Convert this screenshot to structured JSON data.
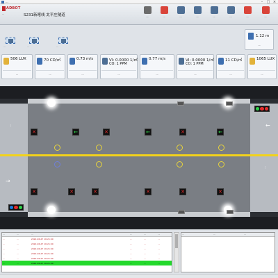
{
  "window": {
    "title": "..."
  },
  "header": {
    "logo_text": "ADBOT",
    "logo_sub": "...",
    "title": "S231新喀线 太平庄隧道",
    "buttons": [
      {
        "label": "...",
        "icon": "panda-icon",
        "color": "#6b6b6b"
      },
      {
        "label": "...",
        "icon": "alert-icon",
        "color": "#d9443a"
      },
      {
        "label": "...",
        "icon": "power-icon",
        "color": "#4d6e94"
      },
      {
        "label": "...",
        "icon": "user-icon",
        "color": "#4d6e94"
      },
      {
        "label": "...",
        "icon": "monitor-icon",
        "color": "#4d6e94"
      },
      {
        "label": "...",
        "icon": "stats-icon",
        "color": "#4d6e94"
      },
      {
        "label": "...",
        "icon": "log-icon",
        "color": "#d9443a"
      },
      {
        "label": "...",
        "icon": "exit-icon",
        "color": "#d9443a"
      }
    ]
  },
  "lane_icons": [
    {
      "label": "..."
    },
    {
      "label": "..."
    },
    {
      "label": "..."
    }
  ],
  "mini_panel": {
    "value": "1.12 m",
    "label": "..."
  },
  "sensors": [
    {
      "value": "506 LUX",
      "value2": "",
      "label": "..."
    },
    {
      "value": "70 CD/㎡",
      "value2": "",
      "label": "..."
    },
    {
      "value": "0.73 m/s",
      "value2": "",
      "label": "..."
    },
    {
      "value": "VI: 0.0000 1/㎡",
      "value2": "CO: 1 PPM",
      "label": "..."
    },
    {
      "value": "0.77 m/s",
      "value2": "",
      "label": "..."
    },
    {
      "value": "VI: 0.0000 1/㎡",
      "value2": "CO: 1 PPM",
      "label": "..."
    },
    {
      "value": "11 CD/㎡",
      "value2": "",
      "label": "..."
    },
    {
      "value": "1065 LUX",
      "value2": "",
      "label": "..."
    }
  ],
  "tunnel": {
    "left_portal_label": "...",
    "right_portal_label": "...",
    "signals_top": [
      "x",
      "arr",
      "x",
      "arr",
      "x",
      "arr",
      "x"
    ],
    "signals_bottom": [
      "x",
      "x",
      "x",
      "x",
      "x",
      "x",
      "x"
    ],
    "direction_left": "→",
    "direction_right": "←",
    "traffic_left_colors": [
      "#1b7ad9",
      "#e32d2d",
      "#2fd04a"
    ],
    "traffic_right_colors": [
      "#2fd04a",
      "#e32d2d",
      "#e32d2d"
    ]
  },
  "alarm_table": {
    "columns": [
      "...",
      "...",
      "...",
      "...",
      "...",
      "..."
    ],
    "rows": [
      [
        "...",
        "...",
        "2022-06-27 16:21:00",
        "...",
        "...",
        "..."
      ],
      [
        "...",
        "...",
        "2022-06-27 16:21:00",
        "...",
        "...",
        "..."
      ],
      [
        "...",
        "...",
        "2022-06-27 16:21:00",
        "...",
        "...",
        "..."
      ],
      [
        "...",
        "...",
        "2022-06-27 16:21:00",
        "...",
        "...",
        "..."
      ],
      [
        "...",
        "...",
        "2022-06-27 16:21:00",
        "...",
        "...",
        "..."
      ],
      [
        "...",
        "...",
        "2022-06-27 16:21:00",
        "...",
        "...",
        "..."
      ]
    ]
  },
  "right_table": {
    "columns": [
      "...",
      "...",
      "..."
    ]
  },
  "status": {
    "text": ""
  }
}
